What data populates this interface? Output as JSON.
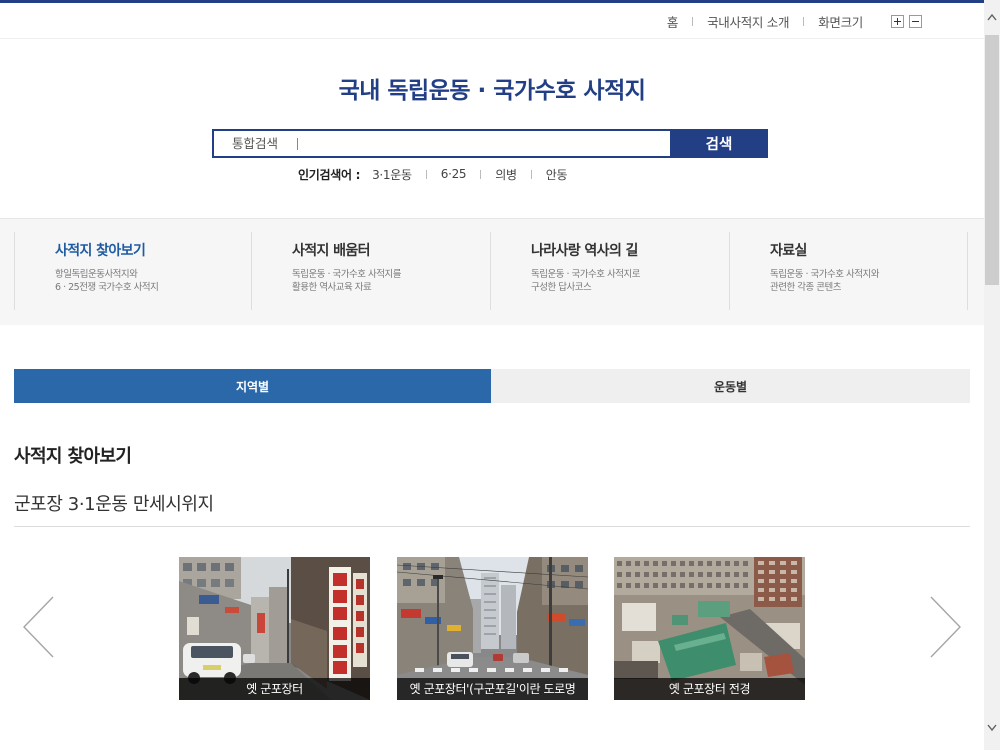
{
  "utility": {
    "home": "홈",
    "about": "국내사적지 소개",
    "screen_size": "화면크기"
  },
  "header": {
    "title": "국내 독립운동 · 국가수호 사적지"
  },
  "search": {
    "scope_label": "통합검색",
    "button": "검색"
  },
  "popular": {
    "label": "인기검색어 :",
    "keywords": [
      "3·1운동",
      "6·25",
      "의병",
      "안동"
    ]
  },
  "menu": [
    {
      "title": "사적지 찾아보기",
      "desc": [
        "항일독립운동사적지와",
        "6 · 25전쟁 국가수호 사적지"
      ],
      "active": true
    },
    {
      "title": "사적지 배움터",
      "desc": [
        "독립운동 · 국가수호 사적지를",
        "활용한 역사교육 자료"
      ],
      "active": false
    },
    {
      "title": "나라사랑 역사의 길",
      "desc": [
        "독립운동 · 국가수호 사적지로",
        "구성한 답사코스"
      ],
      "active": false
    },
    {
      "title": "자료실",
      "desc": [
        "독립운동 · 국가수호 사적지와",
        "관련한 각종 콘텐츠"
      ],
      "active": false
    }
  ],
  "tabs": [
    {
      "label": "지역별",
      "active": true
    },
    {
      "label": "운동별",
      "active": false
    }
  ],
  "content": {
    "section_title": "사적지 찾아보기",
    "site_name": "군포장 3·1운동 만세시위지"
  },
  "gallery": [
    {
      "caption": "옛 군포장터"
    },
    {
      "caption": "옛 군포장터'(구군포길'이란 도로명"
    },
    {
      "caption": "옛 군포장터 전경"
    }
  ],
  "icons": {
    "zoom_in": "plus-icon",
    "zoom_out": "minus-icon",
    "prev": "chevron-left-icon",
    "next": "chevron-right-icon",
    "scroll_up": "scroll-up-arrow-icon",
    "scroll_down": "scroll-down-arrow-icon"
  },
  "colors": {
    "brand_navy": "#223f86",
    "accent_blue": "#2b68aa",
    "menu_active": "#1f5ba3",
    "menu_band": "#f6f6f6",
    "tab_inactive": "#efefef",
    "caption_bar": "rgba(0,0,0,0.72)"
  }
}
